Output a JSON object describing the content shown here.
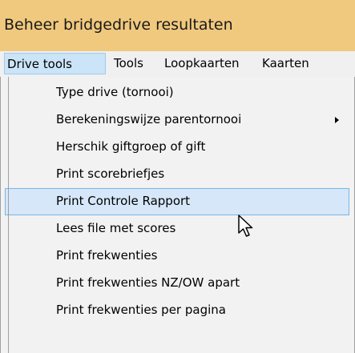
{
  "window": {
    "title": "Beheer bridgedrive resultaten"
  },
  "menubar": {
    "items": [
      {
        "label": "Drive tools",
        "open": true
      },
      {
        "label": "Tools"
      },
      {
        "label": "Loopkaarten"
      },
      {
        "label": "Kaarten"
      }
    ]
  },
  "dropdown": {
    "items": [
      {
        "label": "Type drive (tornooi)"
      },
      {
        "label": "Berekeningswijze parentornooi",
        "submenu": true
      },
      {
        "label": "Herschik giftgroep of gift"
      },
      {
        "label": "Print scorebriefjes"
      },
      {
        "label": "Print Controle Rapport",
        "hovered": true
      },
      {
        "label": "Lees file met scores"
      },
      {
        "label": "Print frekwenties"
      },
      {
        "label": "Print frekwenties NZ/OW apart"
      },
      {
        "label": "Print frekwenties per pagina"
      }
    ]
  },
  "colors": {
    "titlebar": "#f0c97e",
    "menubar": "#f0f0f0",
    "menu_open": "#cce4f7",
    "dropdown_bg": "#f2f2f2",
    "hover_bg": "#d5e7f8",
    "hover_border": "#7ab5e6"
  }
}
